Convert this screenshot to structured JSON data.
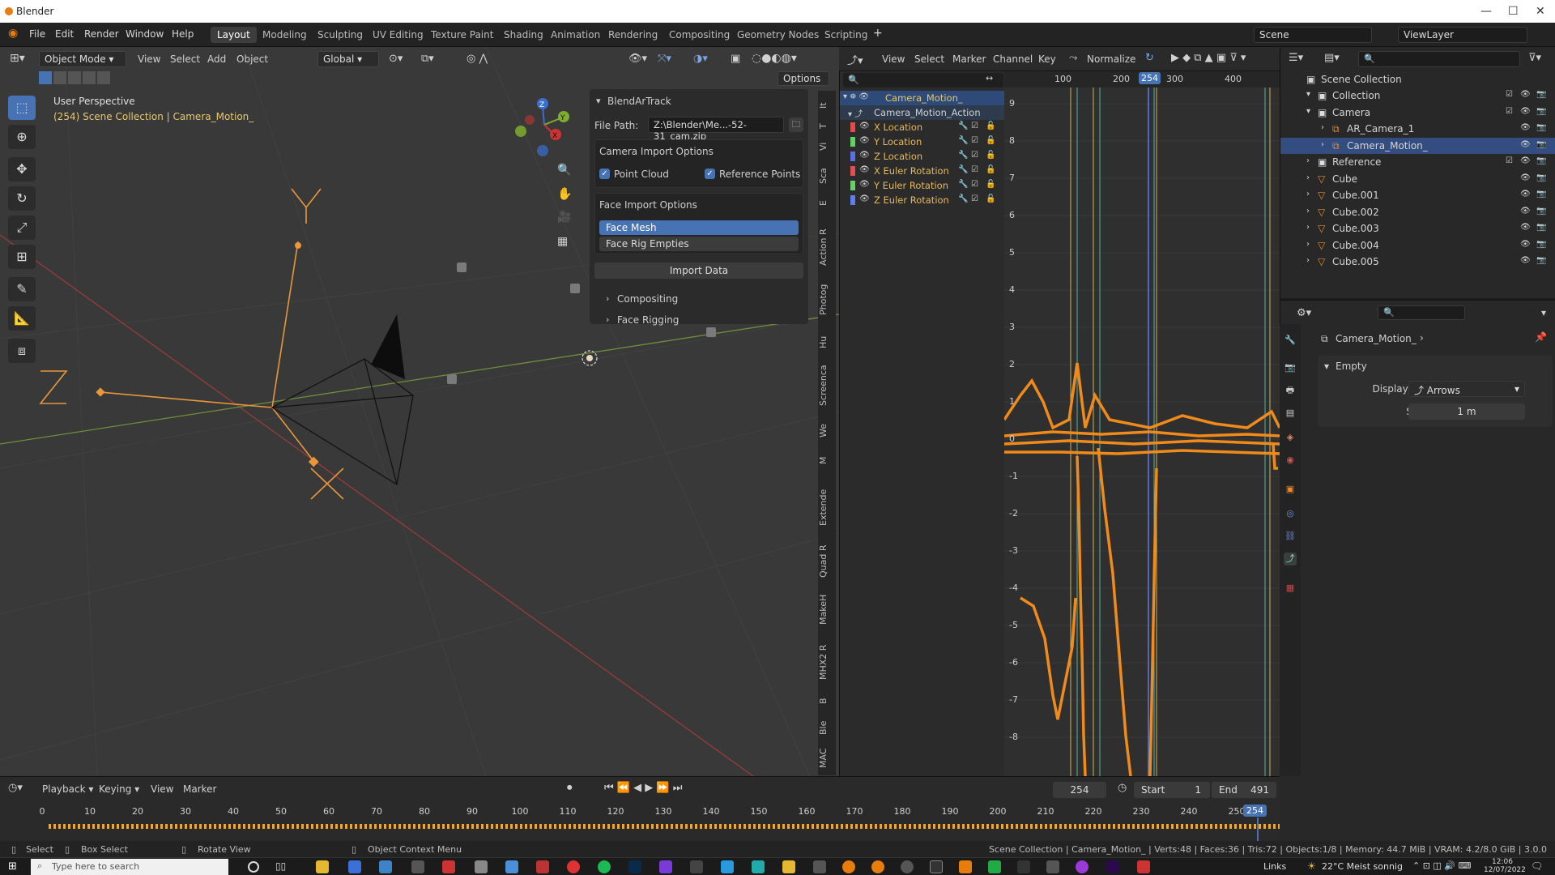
{
  "window": {
    "title": "Blender"
  },
  "menu": [
    "File",
    "Edit",
    "Render",
    "Window",
    "Help"
  ],
  "workspaces": [
    {
      "label": "Layout",
      "active": true
    },
    {
      "label": "Modeling"
    },
    {
      "label": "Sculpting"
    },
    {
      "label": "UV Editing"
    },
    {
      "label": "Texture Paint"
    },
    {
      "label": "Shading"
    },
    {
      "label": "Animation"
    },
    {
      "label": "Rendering"
    },
    {
      "label": "Compositing"
    },
    {
      "label": "Geometry Nodes"
    },
    {
      "label": "Scripting"
    }
  ],
  "scene": {
    "name": "Scene",
    "view_layer": "ViewLayer"
  },
  "viewport": {
    "mode": "Object Mode",
    "menus": [
      "View",
      "Select",
      "Add",
      "Object"
    ],
    "orientation": "Global",
    "options_label": "Options",
    "perspective_label": "User Perspective",
    "context_label": "(254) Scene Collection | Camera_Motion_"
  },
  "npanel": {
    "title": "BlendArTrack",
    "file_path_label": "File Path:",
    "file_path_value": "Z:\\Blender\\Me...-52-31_cam.zip",
    "camera_options_title": "Camera Import Options",
    "point_cloud_label": "Point Cloud",
    "reference_points_label": "Reference Points",
    "face_options_title": "Face Import Options",
    "face_mesh_label": "Face Mesh",
    "face_rig_label": "Face Rig Empties",
    "import_label": "Import Data",
    "compositing_label": "Compositing",
    "face_rigging_label": "Face Rigging"
  },
  "sidebar_tabs": [
    "It",
    "T",
    "Vi",
    "Sca",
    "E",
    "Action R",
    "Photog",
    "Hu",
    "Screenca",
    "We",
    "M",
    "Extende",
    "Quad R",
    "MakeH",
    "MHX2 R",
    "B",
    "Ble",
    "MAC"
  ],
  "graph_editor": {
    "menus": [
      "View",
      "Select",
      "Marker",
      "Channel",
      "Key"
    ],
    "normalize_label": "Normalize",
    "object_name": "Camera_Motion_",
    "action_name": "Camera_Motion_Action",
    "channels": [
      {
        "name": "X Location",
        "color": "#e34a4a"
      },
      {
        "name": "Y Location",
        "color": "#5fd35f"
      },
      {
        "name": "Z Location",
        "color": "#5a6ee6"
      },
      {
        "name": "X Euler Rotation",
        "color": "#e05050"
      },
      {
        "name": "Y Euler Rotation",
        "color": "#68cf68"
      },
      {
        "name": "Z Euler Rotation",
        "color": "#5f7ded"
      }
    ],
    "ruler": [
      "100",
      "200",
      "254",
      "300",
      "400"
    ],
    "y_ticks": [
      "9",
      "8",
      "7",
      "6",
      "5",
      "4",
      "3",
      "2",
      "1",
      "0",
      "-1",
      "-2",
      "-3",
      "-4",
      "-5",
      "-6",
      "-7",
      "-8"
    ]
  },
  "outliner": {
    "root": "Scene Collection",
    "items": [
      {
        "label": "Collection",
        "depth": 1
      },
      {
        "label": "Camera",
        "depth": 1
      },
      {
        "label": "AR_Camera_1",
        "depth": 2
      },
      {
        "label": "Camera_Motion_",
        "depth": 2,
        "selected": true
      },
      {
        "label": "Reference",
        "depth": 1
      },
      {
        "label": "Cube",
        "depth": 1
      },
      {
        "label": "Cube.001",
        "depth": 1
      },
      {
        "label": "Cube.002",
        "depth": 1
      },
      {
        "label": "Cube.003",
        "depth": 1
      },
      {
        "label": "Cube.004",
        "depth": 1
      },
      {
        "label": "Cube.005",
        "depth": 1
      }
    ]
  },
  "properties": {
    "object_name": "Camera_Motion_",
    "panel_title": "Empty",
    "display_as_label": "Display As",
    "display_as_value": "Arrows",
    "size_label": "Size",
    "size_value": "1 m"
  },
  "timeline": {
    "menus": [
      "Playback",
      "Keying",
      "View",
      "Marker"
    ],
    "current_frame": "254",
    "start_label": "Start",
    "start_value": "1",
    "end_label": "End",
    "end_value": "491",
    "ticks": [
      "0",
      "10",
      "20",
      "30",
      "40",
      "50",
      "60",
      "70",
      "80",
      "90",
      "100",
      "110",
      "120",
      "130",
      "140",
      "150",
      "160",
      "170",
      "180",
      "190",
      "200",
      "210",
      "220",
      "230",
      "240",
      "250"
    ],
    "playhead": "254"
  },
  "status": {
    "select": "Select",
    "box_select": "Box Select",
    "rotate_view": "Rotate View",
    "context_menu": "Object Context Menu",
    "stats": "Scene Collection | Camera_Motion_ | Verts:48 | Faces:36 | Tris:72 | Objects:1/8 | Memory: 44.7 MiB | VRAM: 4.2/8.0 GiB | 3.0.0"
  },
  "taskbar": {
    "search_placeholder": "Type here to search",
    "links_label": "Links",
    "weather": "22°C Meist sonnig",
    "time": "12:06",
    "date": "12/07/2022"
  }
}
